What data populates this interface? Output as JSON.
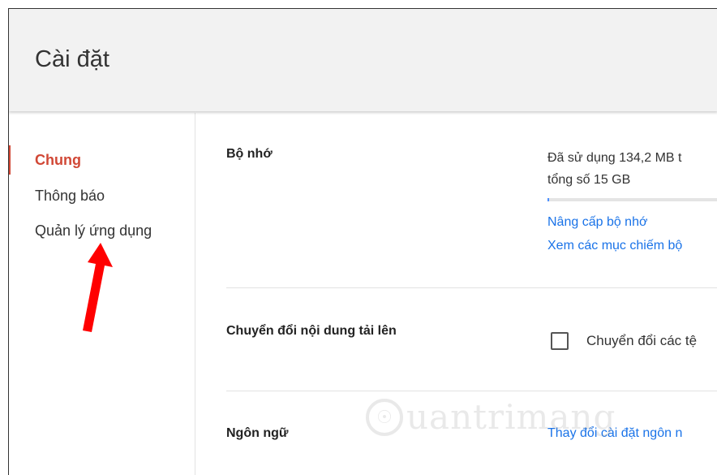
{
  "header": {
    "title": "Cài đặt"
  },
  "sidebar": {
    "items": [
      {
        "label": "Chung",
        "active": true
      },
      {
        "label": "Thông báo",
        "active": false
      },
      {
        "label": "Quản lý ứng dụng",
        "active": false
      }
    ]
  },
  "settings": {
    "storage": {
      "label": "Bộ nhớ",
      "usage_line1": "Đã sử dụng 134,2 MB t",
      "usage_line2": "tổng số 15 GB",
      "usage_fraction": 0.009,
      "upgrade_link": "Nâng cấp bộ nhớ",
      "view_link": "Xem các mục chiếm bộ"
    },
    "convert": {
      "label": "Chuyển đổi nội dung tải lên",
      "checkbox_label": "Chuyển đổi các tệ",
      "checked": false
    },
    "language": {
      "label": "Ngôn ngữ",
      "link": "Thay đổi cài đặt ngôn n"
    }
  },
  "watermark": {
    "text": "uantrimang"
  },
  "colors": {
    "accent_red": "#d14836",
    "link_blue": "#1a73e8",
    "header_bg": "#f2f2f2",
    "arrow_red": "#ff0000"
  }
}
